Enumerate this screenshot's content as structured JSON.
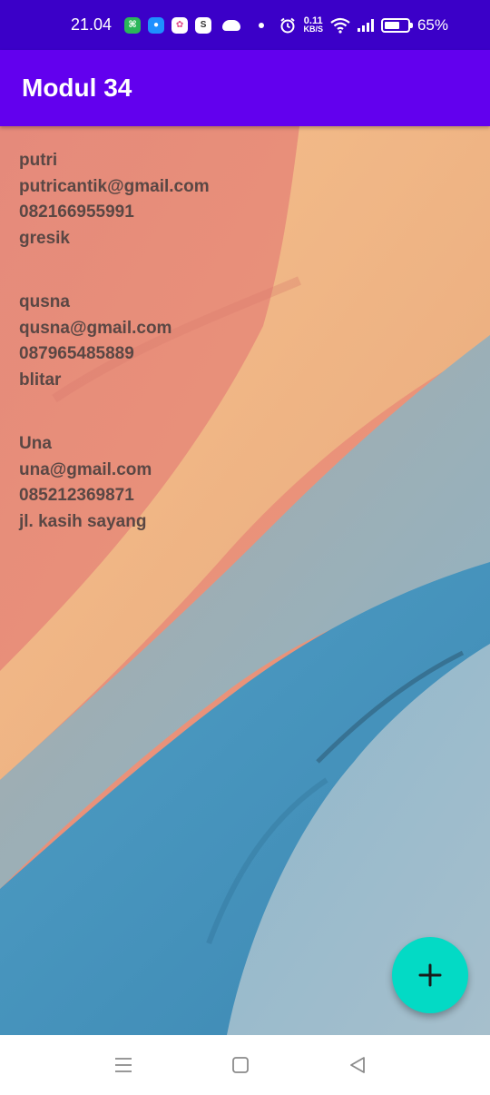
{
  "status_bar": {
    "time": "21.04",
    "net_speed_value": "0.11",
    "net_speed_unit": "KB/S",
    "battery": "65%",
    "battery_level": 0.65
  },
  "app_bar": {
    "title": "Modul 34"
  },
  "contacts": [
    {
      "name": "putri",
      "email": "putricantik@gmail.com",
      "phone": "082166955991",
      "address": "gresik"
    },
    {
      "name": "qusna",
      "email": "qusna@gmail.com",
      "phone": "087965485889",
      "address": "blitar"
    },
    {
      "name": "Una",
      "email": "una@gmail.com",
      "phone": "085212369871",
      "address": "jl. kasih sayang"
    }
  ],
  "fab": {
    "icon": "plus-icon"
  },
  "nav_bar": {
    "icons": [
      "menu-icon",
      "home-square-icon",
      "back-triangle-icon"
    ]
  },
  "colors": {
    "status_bar": "#3b00c8",
    "app_bar": "#6200ee",
    "fab": "#03dac5",
    "text": "#5a4744"
  }
}
